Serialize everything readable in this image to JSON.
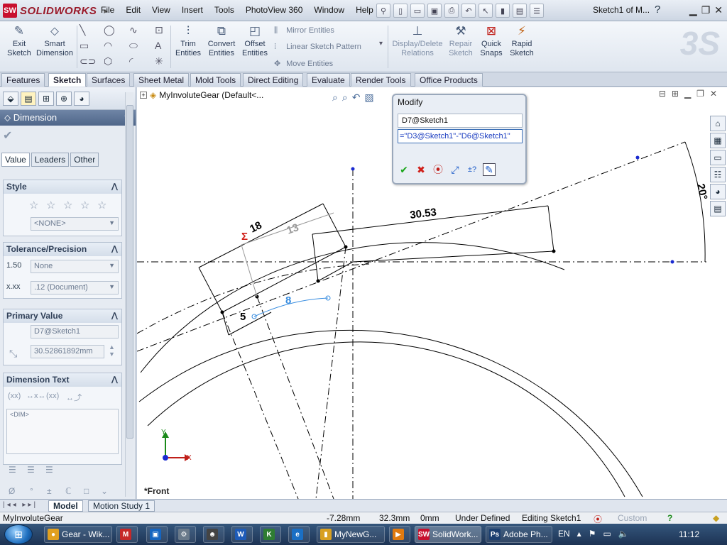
{
  "app": {
    "brand": "SOLIDWORKS",
    "menus": [
      "File",
      "Edit",
      "View",
      "Insert",
      "Tools",
      "PhotoView 360",
      "Window",
      "Help"
    ],
    "doc_title": "Sketch1 of M...",
    "help_icon": "help-icon"
  },
  "commands": {
    "exit_sketch": "Exit Sketch",
    "smart_dimension": "Smart Dimension",
    "trim_entities": "Trim Entities",
    "convert_entities": "Convert Entities",
    "offset_entities": "Offset Entities",
    "mirror_entities": "Mirror Entities",
    "linear_sketch_pattern": "Linear Sketch Pattern",
    "move_entities": "Move Entities",
    "display_delete_relations": "Display/Delete Relations",
    "repair_sketch": "Repair Sketch",
    "quick_snaps": "Quick Snaps",
    "rapid_sketch": "Rapid Sketch"
  },
  "tabs": [
    "Features",
    "Sketch",
    "Surfaces",
    "Sheet Metal",
    "Mold Tools",
    "Direct Editing",
    "Evaluate",
    "Render Tools",
    "Office Products"
  ],
  "active_tab": "Sketch",
  "property_manager": {
    "title": "Dimension",
    "help": "?",
    "subtabs": [
      "Value",
      "Leaders",
      "Other"
    ],
    "style": {
      "header": "Style",
      "value": "<NONE>"
    },
    "tolerance": {
      "header": "Tolerance/Precision",
      "tol_type": "None",
      "precision": ".12 (Document)"
    },
    "primary_value": {
      "header": "Primary Value",
      "name": "D7@Sketch1",
      "value": "30.52861892mm"
    },
    "dimension_text": {
      "header": "Dimension Text",
      "text": "<DIM>"
    }
  },
  "graphics": {
    "tree_item": "MyInvoluteGear  (Default<...",
    "view_label": "*Front",
    "triad_y": "Y",
    "triad_x": "X",
    "dims": {
      "d_sigma": "18",
      "d13": "13",
      "d30": "30.53",
      "d20": "20°",
      "d8": "8",
      "d5": "5"
    },
    "sigma_symbol": "Σ"
  },
  "modify_dialog": {
    "title": "Modify",
    "name": "D7@Sketch1",
    "expression": "=\"D3@Sketch1\"-\"D6@Sketch1\""
  },
  "bottom_tabs": [
    "Model",
    "Motion Study 1"
  ],
  "status": {
    "doc": "MyInvoluteGear",
    "x": "-7.28mm",
    "y": "32.3mm",
    "z": "0mm",
    "state": "Under Defined",
    "editing": "Editing Sketch1",
    "units": "Custom"
  },
  "taskbar": {
    "items": [
      {
        "label": "Gear - Wik...",
        "icon": "chrome-icon",
        "color": "#e0a020"
      },
      {
        "label": "",
        "icon": "gmail-icon",
        "color": "#c62828"
      },
      {
        "label": "",
        "icon": "video-icon",
        "color": "#1565c0"
      },
      {
        "label": "",
        "icon": "tool-icon",
        "color": "#6a7a8a"
      },
      {
        "label": "",
        "icon": "game-icon",
        "color": "#444"
      },
      {
        "label": "",
        "icon": "word-icon",
        "color": "#1e5bb8"
      },
      {
        "label": "",
        "icon": "app-k-icon",
        "color": "#2e7d32"
      },
      {
        "label": "",
        "icon": "ie-icon",
        "color": "#1a6fc4"
      },
      {
        "label": "MyNewG...",
        "icon": "folder-icon",
        "color": "#d8a020"
      },
      {
        "label": "",
        "icon": "media-icon",
        "color": "#e07a10"
      },
      {
        "label": "SolidWork...",
        "icon": "solidworks-icon",
        "color": "#c8102e"
      },
      {
        "label": "Adobe Ph...",
        "icon": "photoshop-icon",
        "color": "#1c3f70"
      }
    ],
    "lang": "EN",
    "time": "11:12"
  }
}
